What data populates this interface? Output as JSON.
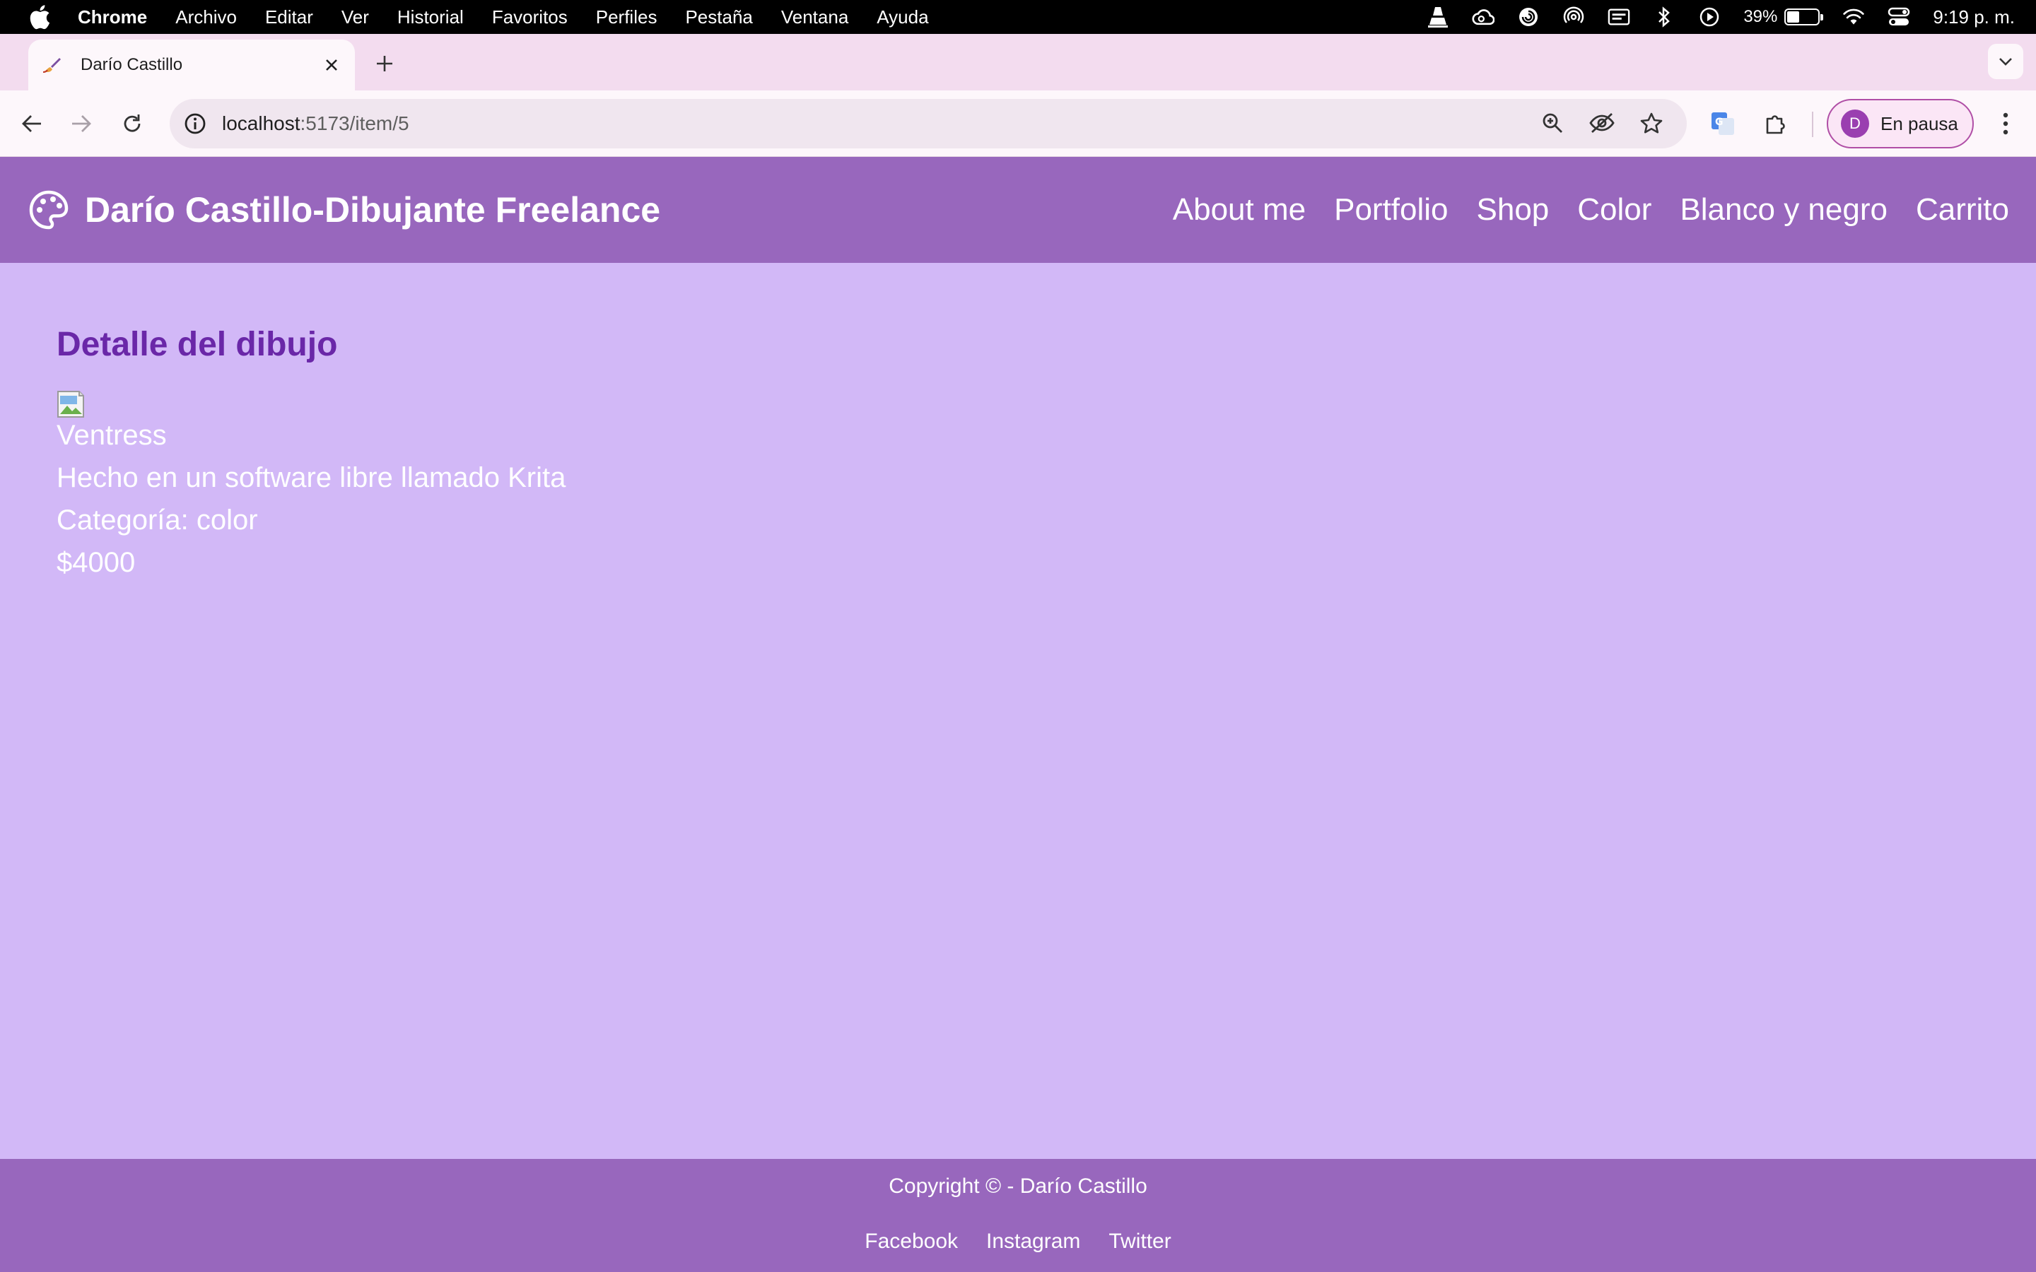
{
  "menubar": {
    "app_name": "Chrome",
    "items": [
      "Archivo",
      "Editar",
      "Ver",
      "Historial",
      "Favoritos",
      "Perfiles",
      "Pestaña",
      "Ventana",
      "Ayuda"
    ],
    "battery_percent": "39%",
    "battery_level": 0.39,
    "clock": "9:19 p. m.",
    "status_icons": [
      "vlc-icon",
      "creative-cloud-icon",
      "spiral-app-icon",
      "airdrop-icon",
      "keyboard-input-icon",
      "bluetooth-icon",
      "play-icon",
      "battery-icon",
      "wifi-icon",
      "control-center-icon"
    ]
  },
  "browser": {
    "tab_title": "Darío Castillo",
    "url_host": "localhost",
    "url_path": ":5173/item/5",
    "profile_initial": "D",
    "profile_status": "En pausa"
  },
  "site": {
    "brand_title": "Darío Castillo-Dibujante Freelance",
    "nav": [
      "About me",
      "Portfolio",
      "Shop",
      "Color",
      "Blanco y negro",
      "Carrito"
    ]
  },
  "detail": {
    "heading": "Detalle del dibujo",
    "name": "Ventress",
    "description": "Hecho en un software libre llamado Krita",
    "category": "Categoría: color",
    "price": "$4000"
  },
  "footer": {
    "copyright": "Copyright © - Darío Castillo",
    "social": [
      "Facebook",
      "Instagram",
      "Twitter"
    ]
  },
  "colors": {
    "page_background": "#d2b8f7",
    "header_footer": "#9867bd",
    "heading_purple": "#6a27a8"
  }
}
